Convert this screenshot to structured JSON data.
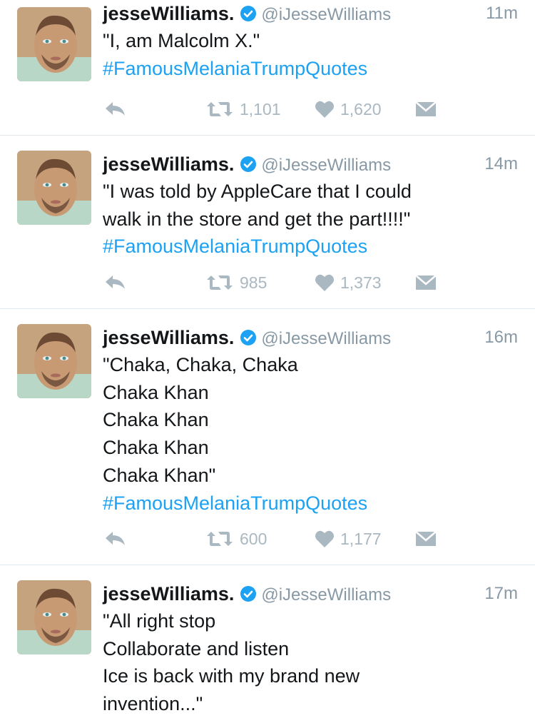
{
  "colors": {
    "link": "#1da1f2",
    "verified": "#1da1f2",
    "action": "#aab8c2",
    "muted": "#8899a6"
  },
  "tweets": [
    {
      "name": "jesseWilliams.",
      "handle": "@iJesseWilliams",
      "time": "11m",
      "lines": [
        "\"I, am Malcolm X.\""
      ],
      "hashtag": "#FamousMelaniaTrumpQuotes",
      "retweets": "1,101",
      "likes": "1,620"
    },
    {
      "name": "jesseWilliams.",
      "handle": "@iJesseWilliams",
      "time": "14m",
      "lines": [
        "\"I was told by AppleCare that I could",
        "walk in the store and get the part!!!!\""
      ],
      "hashtag": "#FamousMelaniaTrumpQuotes",
      "retweets": "985",
      "likes": "1,373"
    },
    {
      "name": "jesseWilliams.",
      "handle": "@iJesseWilliams",
      "time": "16m",
      "lines": [
        "\"Chaka, Chaka, Chaka",
        "Chaka Khan",
        "Chaka Khan",
        "Chaka Khan",
        "Chaka Khan\""
      ],
      "hashtag": "#FamousMelaniaTrumpQuotes",
      "retweets": "600",
      "likes": "1,177"
    },
    {
      "name": "jesseWilliams.",
      "handle": "@iJesseWilliams",
      "time": "17m",
      "lines": [
        "\"All right stop",
        "Collaborate and listen",
        "Ice is back with my brand new",
        "invention...\""
      ]
    }
  ],
  "icons": {
    "reply": "reply-icon",
    "retweet": "retweet-icon",
    "like": "heart-icon",
    "dm": "direct-message-icon",
    "verified": "verified-badge-icon"
  }
}
